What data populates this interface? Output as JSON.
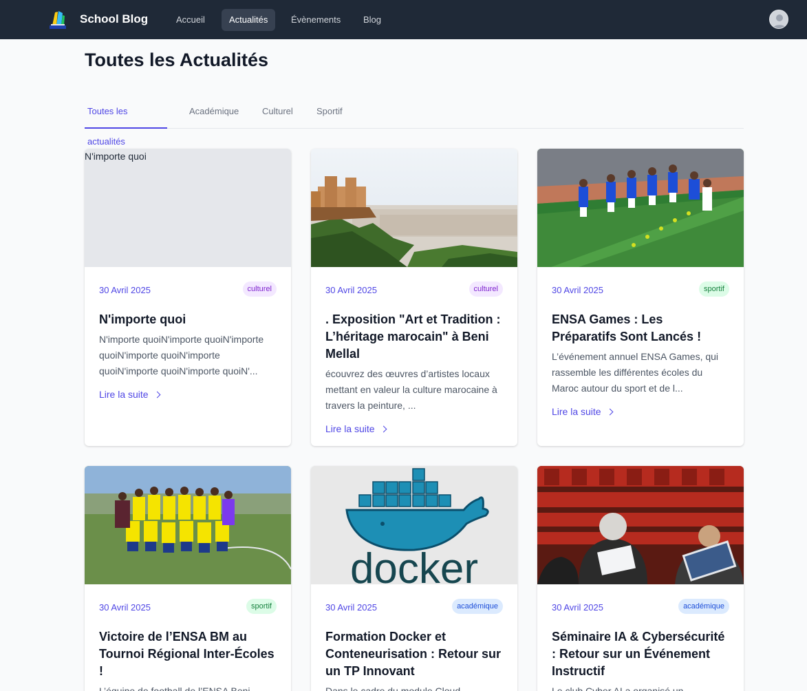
{
  "navbar": {
    "brand": "School Blog",
    "links": [
      "Accueil",
      "Actualités",
      "Évènements",
      "Blog"
    ],
    "active_link": "Actualités",
    "logo_icon": "book-logo-icon",
    "avatar_icon": "user-avatar-icon"
  },
  "page": {
    "title": "Toutes les Actualités"
  },
  "tabs": {
    "items": [
      "Toutes les actualités",
      "Académique",
      "Culturel",
      "Sportif"
    ],
    "active": "Toutes les actualités"
  },
  "read_more_label": "Lire la suite",
  "cards": [
    {
      "image_alt": "N'importe quoi",
      "date": "30 Avril 2025",
      "category": "culturel",
      "title": "N'importe quoi",
      "excerpt": "N'importe quoiN'importe quoiN'importe quoiN'importe quoiN'importe quoiN'importe quoiN'importe quoiN'..."
    },
    {
      "date": "30 Avril 2025",
      "category": "culturel",
      "title": ". Exposition \"Art et Tradition : L’héritage marocain\" à Beni Mellal",
      "excerpt": "écouvrez des œuvres d’artistes locaux mettant en valeur la culture marocaine à travers la peinture, ..."
    },
    {
      "date": "30 Avril 2025",
      "category": "sportif",
      "title": "ENSA Games : Les Préparatifs Sont Lancés !",
      "excerpt": "L’événement annuel ENSA Games, qui rassemble les différentes écoles du Maroc autour du sport et de l..."
    },
    {
      "date": "30 Avril 2025",
      "category": "sportif",
      "title": "Victoire de l’ENSA BM au Tournoi Régional Inter-Écoles !",
      "excerpt": "L’équipe de football de l’ENSA Beni"
    },
    {
      "image_text": "docker",
      "date": "30 Avril 2025",
      "category": "académique",
      "title": "Formation Docker et Conteneurisation : Retour sur un TP Innovant",
      "excerpt": "Dans le cadre du module Cloud"
    },
    {
      "date": "30 Avril 2025",
      "category": "académique",
      "title": "Séminaire IA & Cybersécurité : Retour sur un Événement Instructif",
      "excerpt": "Le club Cyber AI a organisé un"
    }
  ],
  "colors": {
    "navbar_bg": "#1f2937",
    "accent": "#4f46e5",
    "page_bg": "#f9fafb"
  }
}
